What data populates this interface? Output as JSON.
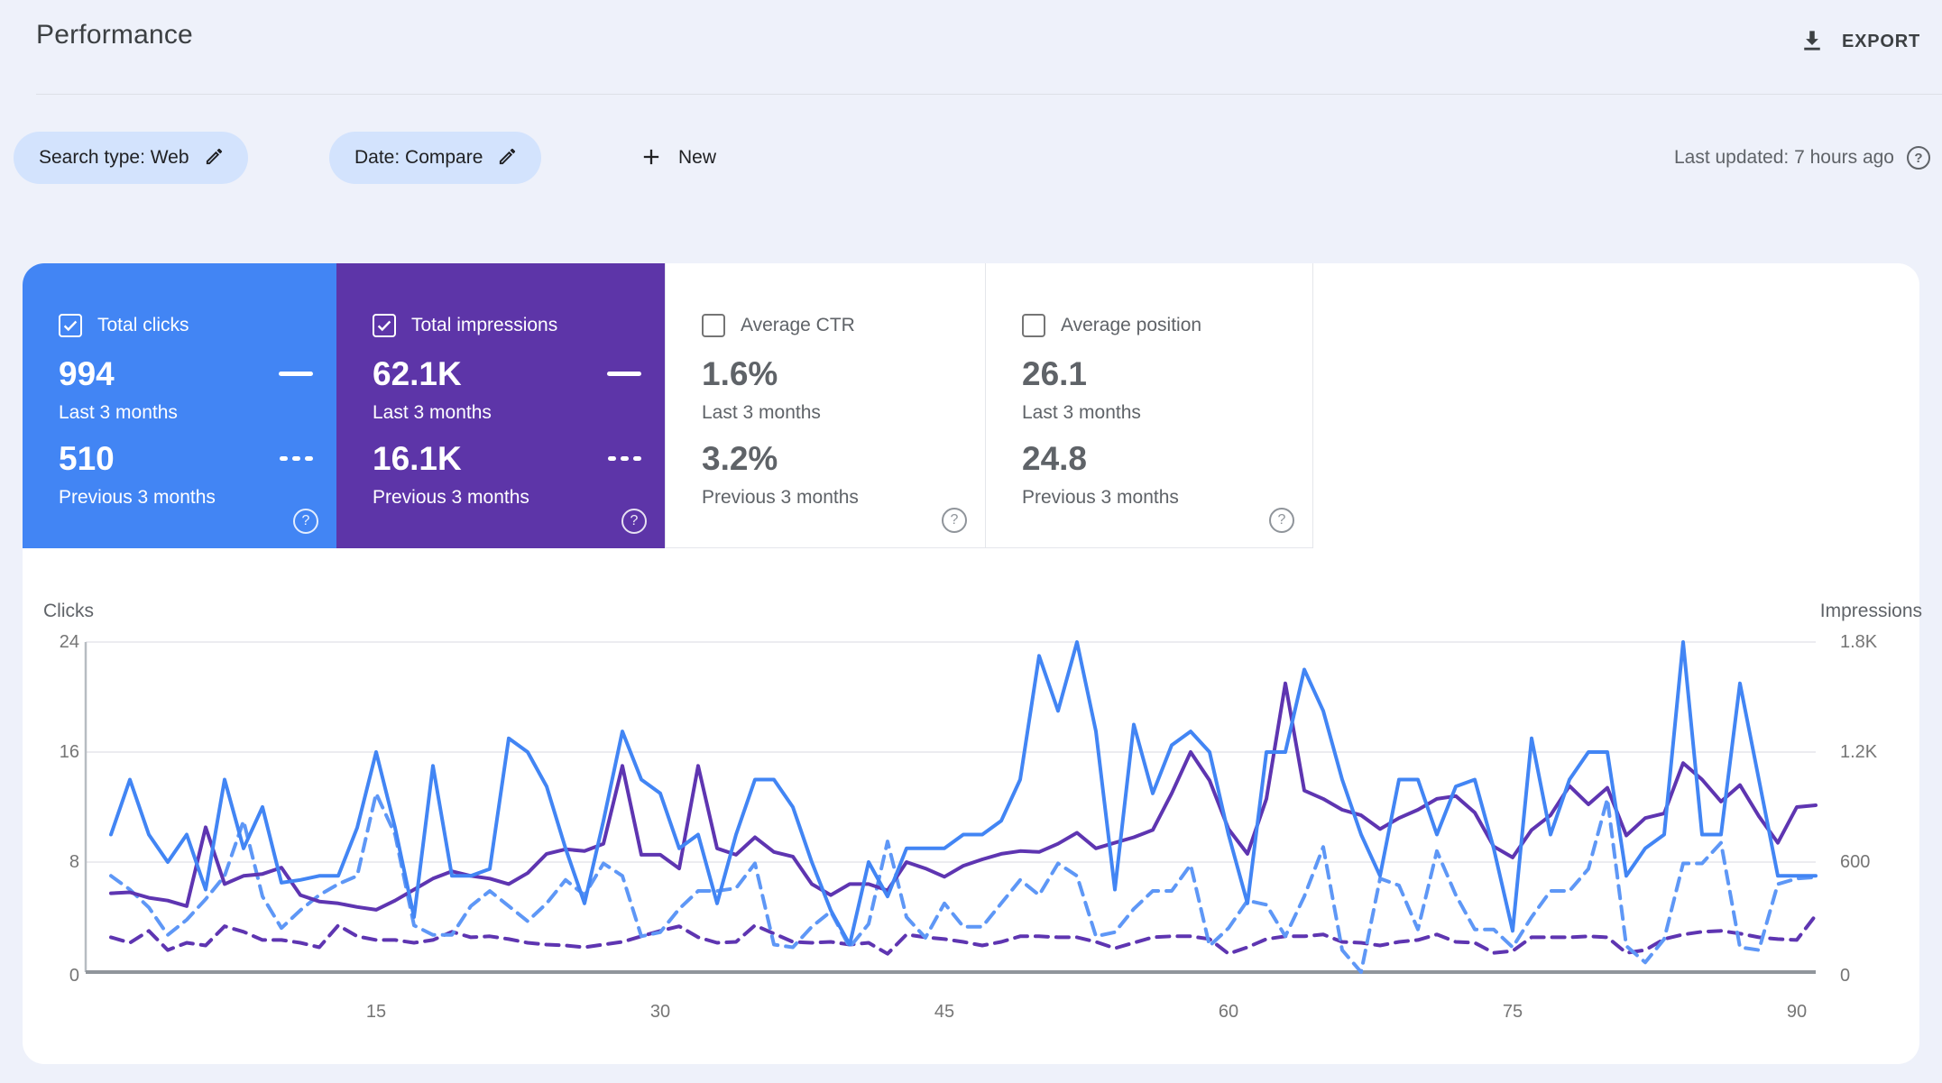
{
  "header": {
    "title": "Performance",
    "export_label": "EXPORT"
  },
  "filters": {
    "search_type_chip": "Search type: Web",
    "date_chip": "Date: Compare",
    "new_label": "New",
    "last_updated": "Last updated: 7 hours ago"
  },
  "cards": [
    {
      "label": "Total clicks",
      "checked": true,
      "color": "#4285f4",
      "value_current": "994",
      "caption_current": "Last 3 months",
      "value_previous": "510",
      "caption_previous": "Previous 3 months"
    },
    {
      "label": "Total impressions",
      "checked": true,
      "color": "#5d35a8",
      "value_current": "62.1K",
      "caption_current": "Last 3 months",
      "value_previous": "16.1K",
      "caption_previous": "Previous 3 months"
    },
    {
      "label": "Average CTR",
      "checked": false,
      "color": "#ffffff",
      "value_current": "1.6%",
      "caption_current": "Last 3 months",
      "value_previous": "3.2%",
      "caption_previous": "Previous 3 months"
    },
    {
      "label": "Average position",
      "checked": false,
      "color": "#ffffff",
      "value_current": "26.1",
      "caption_current": "Last 3 months",
      "value_previous": "24.8",
      "caption_previous": "Previous 3 months"
    }
  ],
  "chart_data": {
    "type": "line",
    "title": "Clicks and impressions, last 3 months vs previous 3 months (by day 1-91)",
    "grid": "horizontal",
    "left_axis": {
      "label": "Clicks",
      "ticks": [
        "24",
        "16",
        "8",
        "0"
      ],
      "min": 0,
      "max": 24
    },
    "right_axis": {
      "label": "Impressions",
      "ticks": [
        "1.8K",
        "1.2K",
        "600",
        "0"
      ],
      "min": 0,
      "max": 1800
    },
    "x_ticks": [
      "15",
      "30",
      "45",
      "60",
      "75",
      "90"
    ],
    "series": [
      {
        "name": "clicks-last-3-months",
        "axis": "left",
        "color": "#4285f4",
        "dash": false,
        "values": [
          10,
          14,
          10,
          8,
          10,
          6,
          14,
          9,
          12,
          6.5,
          6.7,
          7,
          7,
          10.5,
          16,
          10.5,
          4,
          15,
          7,
          7,
          7.5,
          17,
          16,
          13.5,
          9,
          5,
          11,
          17.5,
          14,
          13,
          9,
          10,
          5,
          10,
          14,
          14,
          12,
          8,
          4.5,
          2,
          8,
          5.5,
          9,
          9,
          9,
          10,
          10,
          11,
          14,
          23,
          19,
          24,
          17.5,
          6,
          18,
          13,
          16.5,
          17.5,
          16,
          10,
          5,
          16,
          16,
          22,
          19,
          14,
          10,
          7,
          14,
          14,
          10,
          13.5,
          14,
          9,
          3,
          17,
          10,
          14,
          16,
          16,
          7,
          9,
          10,
          24,
          10,
          10,
          21,
          14,
          7,
          7,
          7
        ]
      },
      {
        "name": "clicks-previous-3-months",
        "axis": "left",
        "color": "#5e97f6",
        "dash": true,
        "values": [
          7,
          6,
          4.7,
          2.7,
          3.8,
          5.3,
          7,
          11,
          5.5,
          3.2,
          4.5,
          5.6,
          6.4,
          7,
          13,
          10,
          3.4,
          2.7,
          2.7,
          4.8,
          5.9,
          4.8,
          3.7,
          5,
          6.7,
          5.6,
          7.9,
          7,
          2.6,
          2.9,
          4.6,
          5.9,
          5.9,
          6.1,
          7.9,
          2,
          1.8,
          3.3,
          4.4,
          1.8,
          3.5,
          9.5,
          4,
          2.5,
          5,
          3.3,
          3.3,
          5,
          6.7,
          5.6,
          7.9,
          7,
          2.6,
          2.9,
          4.6,
          5.9,
          5.9,
          7.8,
          1.9,
          3.2,
          5.2,
          4.9,
          2.6,
          5.5,
          9.1,
          1.6,
          0,
          6.8,
          6.3,
          3.1,
          8.8,
          5.6,
          3.1,
          3.1,
          1.8,
          4,
          5.9,
          5.9,
          7.5,
          12.6,
          1.9,
          0.7,
          2.4,
          7.9,
          7.9,
          9.4,
          1.8,
          1.6,
          6.4,
          6.8,
          6.9
        ]
      },
      {
        "name": "impressions-last-3-months",
        "axis": "right",
        "color": "#5e35b1",
        "dash": false,
        "values": [
          430,
          435,
          405,
          390,
          360,
          790,
          480,
          525,
          535,
          570,
          420,
          385,
          375,
          355,
          340,
          390,
          450,
          510,
          550,
          525,
          510,
          480,
          540,
          645,
          670,
          660,
          700,
          1125,
          640,
          640,
          565,
          1125,
          675,
          640,
          735,
          655,
          630,
          480,
          420,
          480,
          480,
          445,
          600,
          565,
          520,
          580,
          615,
          645,
          660,
          655,
          700,
          760,
          675,
          705,
          735,
          775,
          975,
          1200,
          1045,
          780,
          645,
          945,
          1575,
          990,
          945,
          885,
          855,
          780,
          840,
          885,
          945,
          960,
          870,
          685,
          625,
          775,
          855,
          1015,
          915,
          1005,
          745,
          840,
          865,
          1140,
          1050,
          930,
          1020,
          850,
          705,
          900,
          910
        ]
      },
      {
        "name": "impressions-previous-3-months",
        "axis": "right",
        "color": "#5e35b1",
        "dash": true,
        "values": [
          190,
          160,
          225,
          120,
          160,
          145,
          250,
          220,
          175,
          175,
          160,
          135,
          255,
          195,
          175,
          175,
          160,
          175,
          220,
          190,
          195,
          180,
          160,
          150,
          145,
          135,
          150,
          165,
          195,
          225,
          250,
          190,
          160,
          165,
          255,
          210,
          165,
          160,
          165,
          150,
          160,
          100,
          205,
          190,
          180,
          165,
          145,
          165,
          195,
          195,
          190,
          190,
          165,
          130,
          160,
          190,
          195,
          195,
          180,
          100,
          135,
          180,
          195,
          195,
          205,
          165,
          160,
          145,
          165,
          175,
          205,
          165,
          160,
          105,
          115,
          190,
          190,
          190,
          195,
          190,
          105,
          120,
          180,
          205,
          220,
          225,
          210,
          190,
          180,
          175,
          310
        ]
      }
    ]
  }
}
